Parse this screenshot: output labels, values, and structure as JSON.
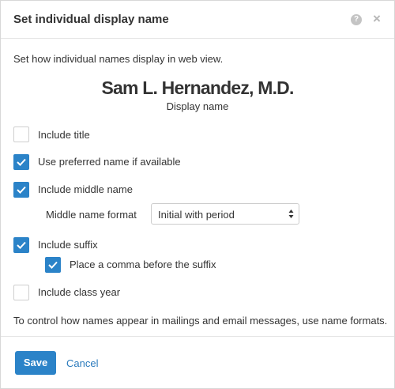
{
  "dialog": {
    "title": "Set individual display name",
    "help_icon": "question-circle-icon",
    "help_glyph": "?",
    "close_icon": "close-icon",
    "close_glyph": "×"
  },
  "intro": "Set how individual names display in web view.",
  "preview": {
    "name": "Sam L. Hernandez, M.D.",
    "caption": "Display name"
  },
  "options": {
    "include_title": {
      "label": "Include title",
      "checked": false
    },
    "use_preferred": {
      "label": "Use preferred name if available",
      "checked": true
    },
    "include_middle": {
      "label": "Include middle name",
      "checked": true
    },
    "include_suffix": {
      "label": "Include suffix",
      "checked": true
    },
    "comma_before_suffix": {
      "label": "Place a comma before the suffix",
      "checked": true
    },
    "include_class_year": {
      "label": "Include class year",
      "checked": false
    }
  },
  "middle_format": {
    "label": "Middle name format",
    "selected": "Initial with period"
  },
  "footer_note": "To control how names appear in mailings and email messages, use name formats.",
  "buttons": {
    "save": "Save",
    "cancel": "Cancel"
  },
  "colors": {
    "accent": "#2b83c8",
    "link": "#2b7bbd"
  }
}
